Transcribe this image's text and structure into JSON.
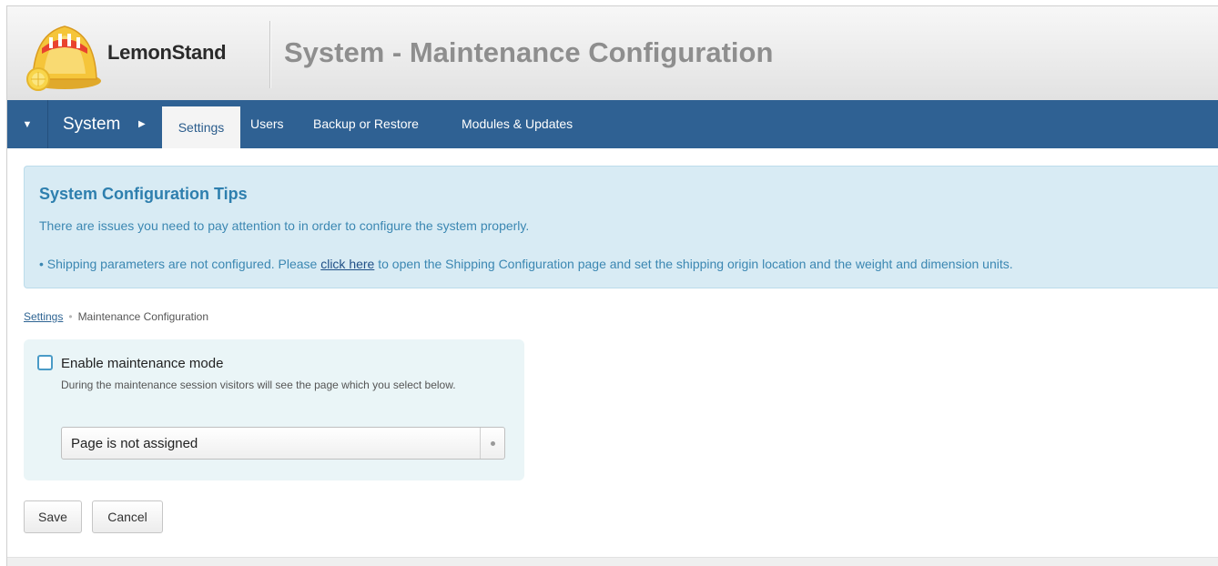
{
  "header": {
    "logo_text": "LemonStand",
    "page_title": "System - Maintenance Configuration"
  },
  "nav": {
    "toggle_icon": "triangle-down-icon",
    "section": "System",
    "section_arrow_icon": "triangle-right-icon",
    "tabs": [
      {
        "label": "Settings",
        "active": true
      },
      {
        "label": "Users",
        "active": false
      },
      {
        "label": "Backup or Restore",
        "active": false
      },
      {
        "label": "Modules & Updates",
        "active": false
      }
    ]
  },
  "tips": {
    "title": "System Configuration Tips",
    "text": "There are issues you need to pay attention to in order to configure the system properly.",
    "item_before": "Shipping parameters are not configured. Please",
    "item_link": "click here",
    "item_after": "to open the Shipping Configuration page and set the shipping origin location and the weight and dimension units."
  },
  "breadcrumb": {
    "parent": "Settings",
    "current": "Maintenance Configuration"
  },
  "form": {
    "checkbox_label": "Enable maintenance mode",
    "checkbox_checked": false,
    "help_text": "During the maintenance session visitors will see the page which you select below.",
    "select_value": "Page is not assigned"
  },
  "buttons": {
    "save": "Save",
    "cancel": "Cancel"
  },
  "colors": {
    "nav_bg": "#2f6193",
    "tips_bg": "#d8ebf4",
    "tips_title": "#2e7fae",
    "form_bg": "#eaf5f7"
  }
}
